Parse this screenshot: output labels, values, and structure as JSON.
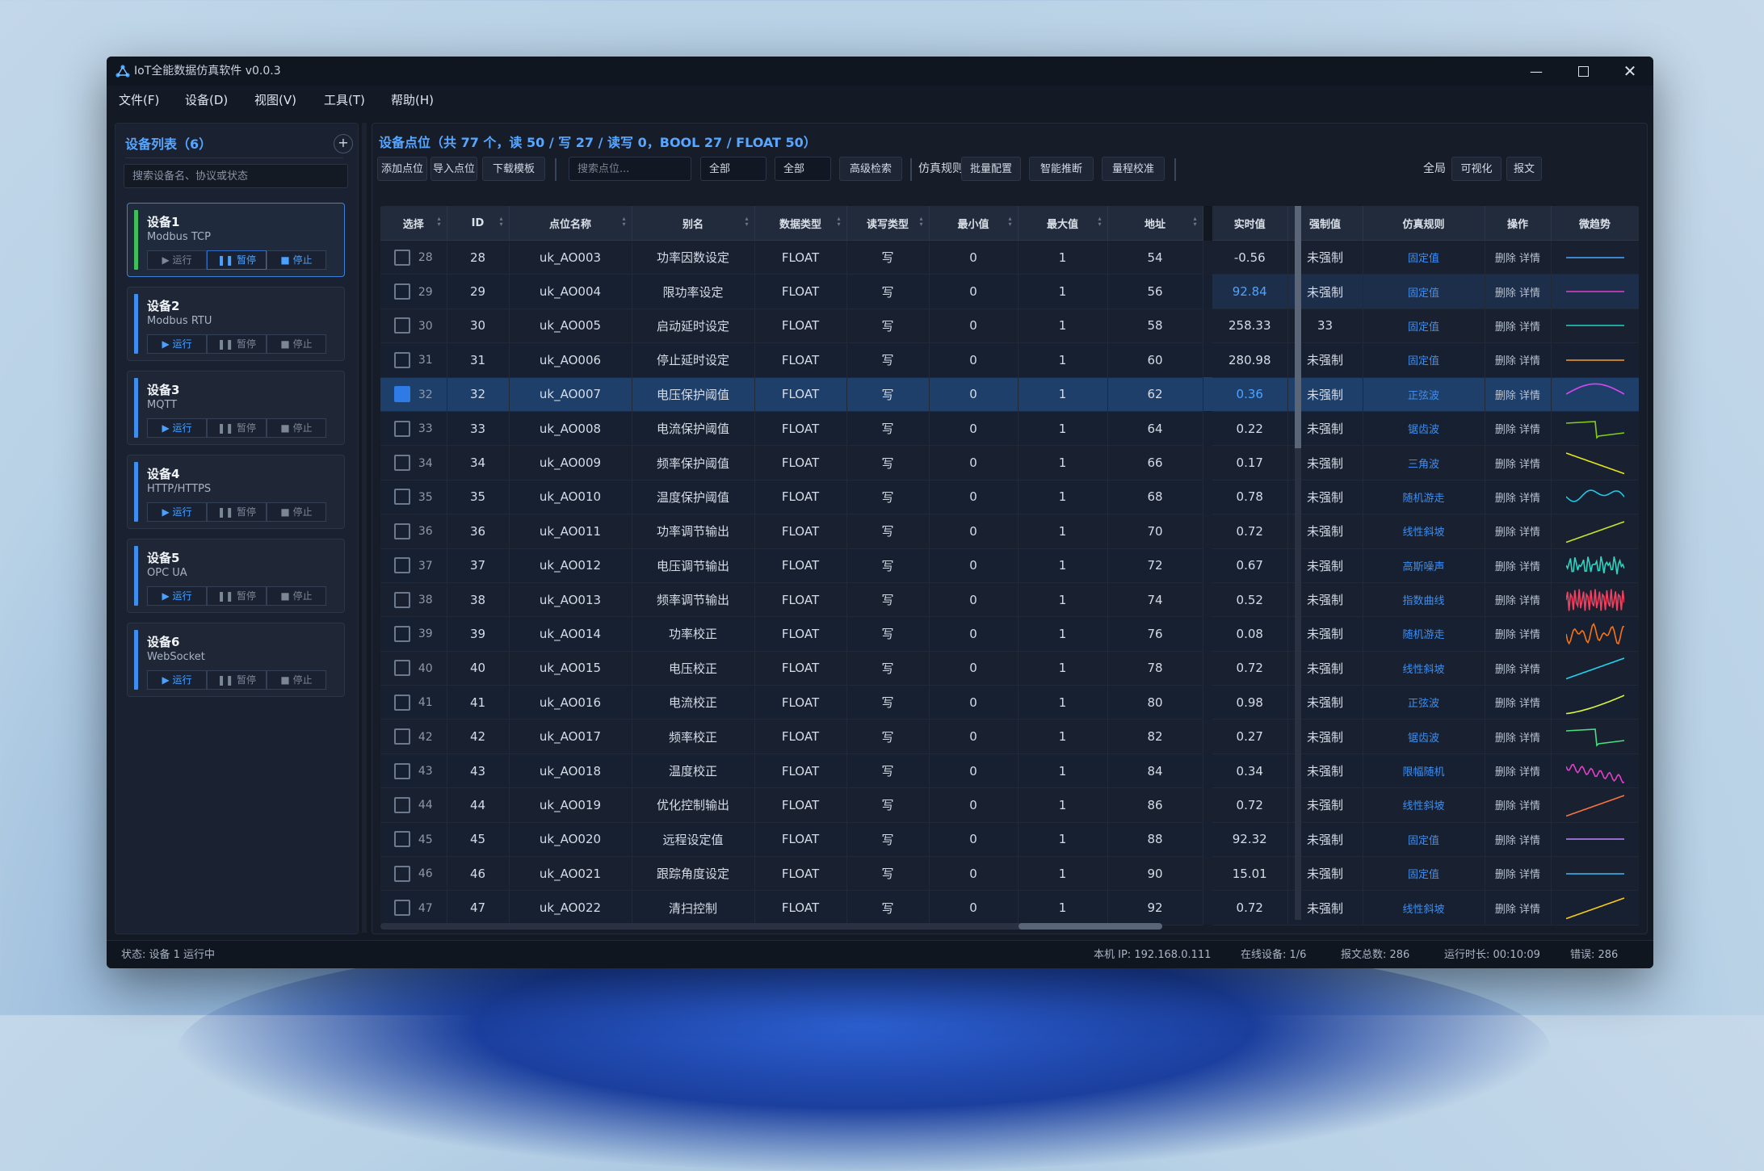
{
  "window": {
    "title": "IoT全能数据仿真软件 v0.0.3"
  },
  "menu": [
    "文件(F)",
    "设备(D)",
    "视图(V)",
    "工具(T)",
    "帮助(H)"
  ],
  "sidebar": {
    "title": "设备列表（6）",
    "add_label": "+",
    "search_placeholder": "搜索设备名、协议或状态",
    "btn_run": "▶ 运行",
    "btn_pause": "❚❚ 暂停",
    "btn_stop": "■ 停止",
    "devices": [
      {
        "name": "设备1",
        "protocol": "Modbus TCP"
      },
      {
        "name": "设备2",
        "protocol": "Modbus RTU"
      },
      {
        "name": "设备3",
        "protocol": "MQTT"
      },
      {
        "name": "设备4",
        "protocol": "HTTP/HTTPS"
      },
      {
        "name": "设备5",
        "protocol": "OPC UA"
      },
      {
        "name": "设备6",
        "protocol": "WebSocket"
      }
    ]
  },
  "main": {
    "title": "设备点位（共 77 个，读 50 / 写 27 / 读写 0，BOOL 27 / FLOAT 50）",
    "toolbar": {
      "add": "添加点位",
      "import": "导入点位",
      "download": "下载模板",
      "search_placeholder": "搜索点位...",
      "filter1": "全部",
      "filter2": "全部",
      "advanced": "高级检索",
      "sim_rule": "仿真规则",
      "batch": "批量配置",
      "smart": "智能推断",
      "range": "量程校准",
      "global": "全局",
      "visual": "可视化",
      "message": "报文"
    },
    "columns": [
      "选择",
      "ID",
      "点位名称",
      "别名",
      "数据类型",
      "读写类型",
      "最小值",
      "最大值",
      "地址",
      "实时值",
      "强制值",
      "仿真规则",
      "操作",
      "微趋势"
    ],
    "op_label": "删除 详情",
    "rows": [
      {
        "idx": "28",
        "id": "28",
        "name": "uk_AO003",
        "alias": "功率因数设定",
        "type": "FLOAT",
        "rw": "写",
        "min": "0",
        "max": "1",
        "addr": "54",
        "rv": "-0.56",
        "force": "未强制",
        "rule": "固定值",
        "trend": "flat",
        "color": "#4aa8ff"
      },
      {
        "idx": "29",
        "id": "29",
        "name": "uk_AO004",
        "alias": "限功率设定",
        "type": "FLOAT",
        "rw": "写",
        "min": "0",
        "max": "1",
        "addr": "56",
        "rv": "92.84",
        "force": "未强制",
        "rule": "固定值",
        "trend": "flat",
        "color": "#e040c8"
      },
      {
        "idx": "30",
        "id": "30",
        "name": "uk_AO005",
        "alias": "启动延时设定",
        "type": "FLOAT",
        "rw": "写",
        "min": "0",
        "max": "1",
        "addr": "58",
        "rv": "258.33",
        "force": "33",
        "rule": "固定值",
        "trend": "flat",
        "color": "#22d3c5"
      },
      {
        "idx": "31",
        "id": "31",
        "name": "uk_AO006",
        "alias": "停止延时设定",
        "type": "FLOAT",
        "rw": "写",
        "min": "0",
        "max": "1",
        "addr": "60",
        "rv": "280.98",
        "force": "未强制",
        "rule": "固定值",
        "trend": "flat",
        "color": "#f59e2b"
      },
      {
        "idx": "32",
        "id": "32",
        "name": "uk_AO007",
        "alias": "电压保护阈值",
        "type": "FLOAT",
        "rw": "写",
        "min": "0",
        "max": "1",
        "addr": "62",
        "rv": "0.36",
        "force": "未强制",
        "rule": "正弦波",
        "trend": "sine",
        "color": "#d946ef"
      },
      {
        "idx": "33",
        "id": "33",
        "name": "uk_AO008",
        "alias": "电流保护阈值",
        "type": "FLOAT",
        "rw": "写",
        "min": "0",
        "max": "1",
        "addr": "64",
        "rv": "0.22",
        "force": "未强制",
        "rule": "锯齿波",
        "trend": "saw",
        "color": "#84cc16"
      },
      {
        "idx": "34",
        "id": "34",
        "name": "uk_AO009",
        "alias": "频率保护阈值",
        "type": "FLOAT",
        "rw": "写",
        "min": "0",
        "max": "1",
        "addr": "66",
        "rv": "0.17",
        "force": "未强制",
        "rule": "三角波",
        "trend": "tri",
        "color": "#e6e619"
      },
      {
        "idx": "35",
        "id": "35",
        "name": "uk_AO010",
        "alias": "温度保护阈值",
        "type": "FLOAT",
        "rw": "写",
        "min": "0",
        "max": "1",
        "addr": "68",
        "rv": "0.78",
        "force": "未强制",
        "rule": "随机游走",
        "trend": "walk",
        "color": "#22c7e6"
      },
      {
        "idx": "36",
        "id": "36",
        "name": "uk_AO011",
        "alias": "功率调节输出",
        "type": "FLOAT",
        "rw": "写",
        "min": "0",
        "max": "1",
        "addr": "70",
        "rv": "0.72",
        "force": "未强制",
        "rule": "线性斜坡",
        "trend": "ramp",
        "color": "#c6e62a"
      },
      {
        "idx": "37",
        "id": "37",
        "name": "uk_AO012",
        "alias": "电压调节输出",
        "type": "FLOAT",
        "rw": "写",
        "min": "0",
        "max": "1",
        "addr": "72",
        "rv": "0.67",
        "force": "未强制",
        "rule": "高斯噪声",
        "trend": "noise",
        "color": "#2dd4bf"
      },
      {
        "idx": "38",
        "id": "38",
        "name": "uk_AO013",
        "alias": "频率调节输出",
        "type": "FLOAT",
        "rw": "写",
        "min": "0",
        "max": "1",
        "addr": "74",
        "rv": "0.52",
        "force": "未强制",
        "rule": "指数曲线",
        "trend": "dense",
        "color": "#f43f5e"
      },
      {
        "idx": "39",
        "id": "39",
        "name": "uk_AO014",
        "alias": "功率校正",
        "type": "FLOAT",
        "rw": "写",
        "min": "0",
        "max": "1",
        "addr": "76",
        "rv": "0.08",
        "force": "未强制",
        "rule": "随机游走",
        "trend": "zig",
        "color": "#f97316"
      },
      {
        "idx": "40",
        "id": "40",
        "name": "uk_AO015",
        "alias": "电压校正",
        "type": "FLOAT",
        "rw": "写",
        "min": "0",
        "max": "1",
        "addr": "78",
        "rv": "0.72",
        "force": "未强制",
        "rule": "线性斜坡",
        "trend": "ramp",
        "color": "#22d3ee"
      },
      {
        "idx": "41",
        "id": "41",
        "name": "uk_AO016",
        "alias": "电流校正",
        "type": "FLOAT",
        "rw": "写",
        "min": "0",
        "max": "1",
        "addr": "80",
        "rv": "0.98",
        "force": "未强制",
        "rule": "正弦波",
        "trend": "rise",
        "color": "#d9f542"
      },
      {
        "idx": "42",
        "id": "42",
        "name": "uk_AO017",
        "alias": "频率校正",
        "type": "FLOAT",
        "rw": "写",
        "min": "0",
        "max": "1",
        "addr": "82",
        "rv": "0.27",
        "force": "未强制",
        "rule": "锯齿波",
        "trend": "saw",
        "color": "#4ade80"
      },
      {
        "idx": "43",
        "id": "43",
        "name": "uk_AO018",
        "alias": "温度校正",
        "type": "FLOAT",
        "rw": "写",
        "min": "0",
        "max": "1",
        "addr": "84",
        "rv": "0.34",
        "force": "未强制",
        "rule": "限幅随机",
        "trend": "decay",
        "color": "#e040c8"
      },
      {
        "idx": "44",
        "id": "44",
        "name": "uk_AO019",
        "alias": "优化控制输出",
        "type": "FLOAT",
        "rw": "写",
        "min": "0",
        "max": "1",
        "addr": "86",
        "rv": "0.72",
        "force": "未强制",
        "rule": "线性斜坡",
        "trend": "ramp",
        "color": "#f97340"
      },
      {
        "idx": "45",
        "id": "45",
        "name": "uk_AO020",
        "alias": "远程设定值",
        "type": "FLOAT",
        "rw": "写",
        "min": "0",
        "max": "1",
        "addr": "88",
        "rv": "92.32",
        "force": "未强制",
        "rule": "固定值",
        "trend": "flat",
        "color": "#c084fc"
      },
      {
        "idx": "46",
        "id": "46",
        "name": "uk_AO021",
        "alias": "跟踪角度设定",
        "type": "FLOAT",
        "rw": "写",
        "min": "0",
        "max": "1",
        "addr": "90",
        "rv": "15.01",
        "force": "未强制",
        "rule": "固定值",
        "trend": "flat",
        "color": "#38bdf8"
      },
      {
        "idx": "47",
        "id": "47",
        "name": "uk_AO022",
        "alias": "清扫控制",
        "type": "FLOAT",
        "rw": "写",
        "min": "0",
        "max": "1",
        "addr": "92",
        "rv": "0.72",
        "force": "未强制",
        "rule": "线性斜坡",
        "trend": "ramp",
        "color": "#facc15"
      }
    ]
  },
  "status": {
    "left": "状态: 设备 1 运行中",
    "ip": "本机 IP: 192.168.0.111",
    "online": "在线设备: 1/6",
    "msgs": "报文总数: 286",
    "uptime": "运行时长: 00:10:09",
    "errors": "错误: 286"
  }
}
